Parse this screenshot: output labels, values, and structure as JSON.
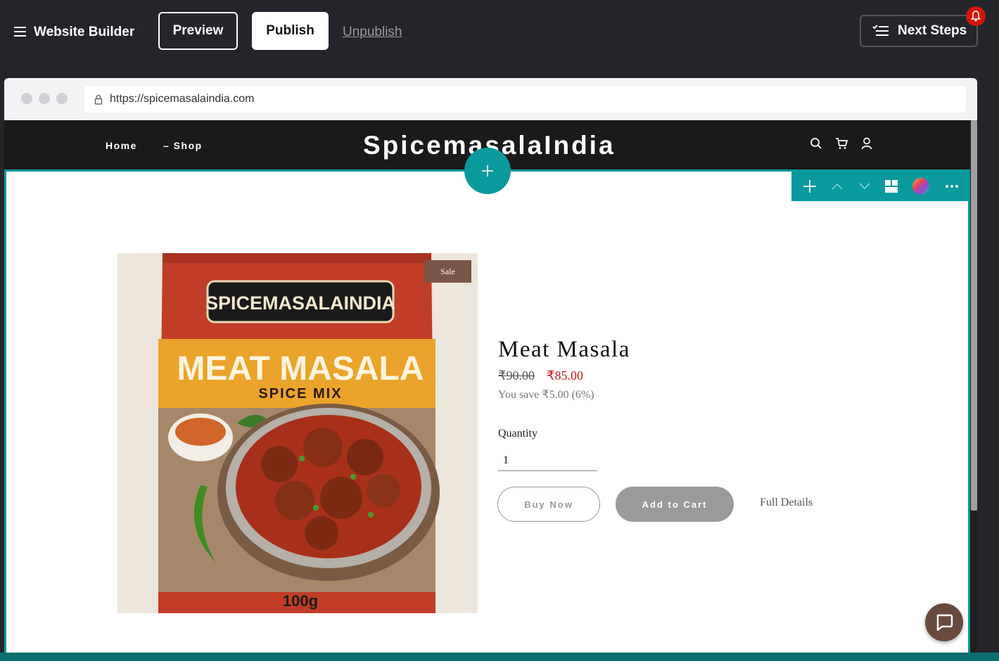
{
  "editor": {
    "app_title": "Website Builder",
    "preview_label": "Preview",
    "publish_label": "Publish",
    "unpublish_label": "Unpublish",
    "next_steps_label": "Next Steps"
  },
  "browser": {
    "url": "https://spicemasalaindia.com"
  },
  "site": {
    "logo": "SpicemasalaIndia",
    "nav": [
      {
        "label": "Home"
      },
      {
        "label": "– Shop"
      }
    ],
    "icons": [
      "search-icon",
      "cart-icon",
      "account-icon"
    ]
  },
  "product": {
    "badge": "Sale",
    "packet_brand": "SPICEMASALAINDIA",
    "packet_name": "MEAT MASALA",
    "packet_sub": "SPICE MIX",
    "packet_weight": "100g",
    "title": "Meat Masala",
    "old_price": "₹90.00",
    "new_price": "₹85.00",
    "savings": "You save ₹5.00 (6%)",
    "quantity_label": "Quantity",
    "quantity_value": "1",
    "buy_now_label": "Buy Now",
    "add_to_cart_label": "Add to Cart",
    "full_details_label": "Full Details"
  },
  "colors": {
    "accent": "#0a9a9d",
    "sale_badge": "#7b5648",
    "sale_price": "#c8141b",
    "notification": "#d1160b"
  }
}
